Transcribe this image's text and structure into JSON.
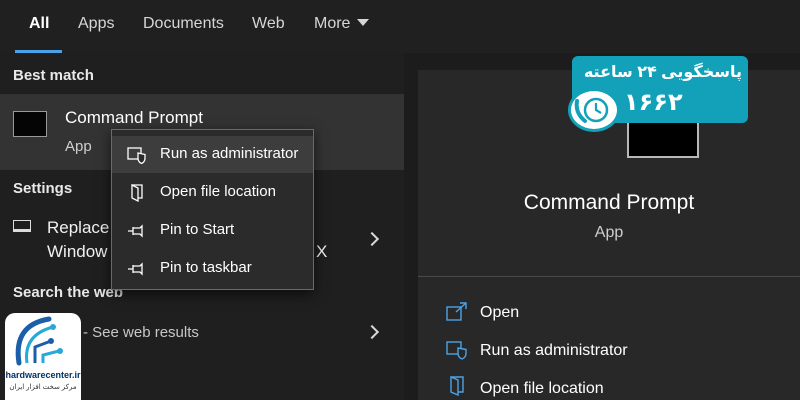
{
  "tabs": {
    "all": "All",
    "apps": "Apps",
    "documents": "Documents",
    "web": "Web",
    "more": "More"
  },
  "left": {
    "best_match_header": "Best match",
    "best_match": {
      "title": "Command Prompt",
      "subtitle": "App"
    },
    "settings_header": "Settings",
    "settings_result": {
      "line1": "Replace",
      "line2": "Window",
      "line1_tail": "",
      "line2_tail": "X"
    },
    "search_web_header": "Search the web",
    "web_result": {
      "query": "d",
      "suffix": " - See web results"
    }
  },
  "context_menu": {
    "items": [
      {
        "label": "Run as administrator",
        "icon": "shield-icon"
      },
      {
        "label": "Open file location",
        "icon": "folder-icon"
      },
      {
        "label": "Pin to Start",
        "icon": "pin-icon"
      },
      {
        "label": "Pin to taskbar",
        "icon": "pin-icon"
      }
    ]
  },
  "detail": {
    "title": "Command Prompt",
    "subtitle": "App",
    "actions": [
      {
        "label": "Open",
        "icon": "open-icon"
      },
      {
        "label": "Run as administrator",
        "icon": "shield-icon"
      },
      {
        "label": "Open file location",
        "icon": "folder-icon"
      }
    ]
  },
  "ad_badge": {
    "line1": "پاسخگویی ۲۴ ساعته",
    "line2": "۱۶۶۲",
    "color": "#12a1b8"
  },
  "watermark": {
    "site": "hardwarecenter.ir",
    "tagline": "مرکز سخت افزار ایران"
  },
  "colors": {
    "accent": "#4aa3e8",
    "background": "#1c1c1c",
    "selected_row": "#333333"
  }
}
